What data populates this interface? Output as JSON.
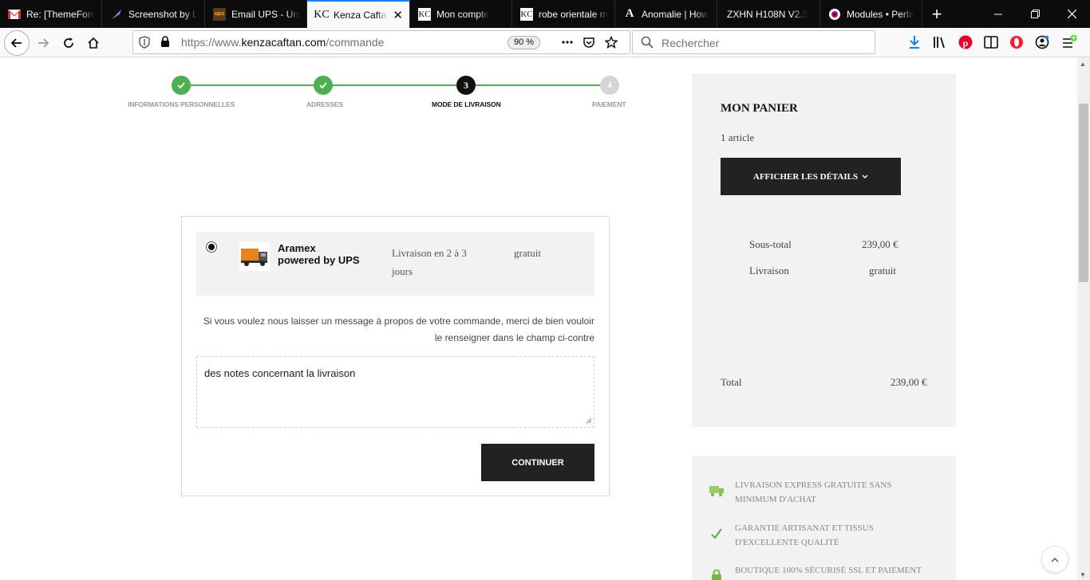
{
  "browser": {
    "tabs": [
      {
        "label": "Re: [ThemeForest]",
        "icon": "gmail-icon",
        "active": false
      },
      {
        "label": "Screenshot by Lightshot",
        "icon": "lightshot-icon",
        "active": false
      },
      {
        "label": "Email UPS - United States",
        "icon": "ups-icon",
        "active": false
      },
      {
        "label": "Kenza Caftan",
        "icon": "kc-icon",
        "active": true
      },
      {
        "label": "Mon compte",
        "icon": "kc-icon",
        "active": false
      },
      {
        "label": "robe orientale mariage",
        "icon": "kc-icon",
        "active": false
      },
      {
        "label": "Anomalie | How",
        "icon": "anomalie-icon",
        "active": false
      },
      {
        "label": "ZXHN H108N V2.3",
        "icon": "",
        "active": false
      },
      {
        "label": "Modules • Perla",
        "icon": "prestashop-icon",
        "active": false
      }
    ],
    "url_prefix": "https://www.",
    "url_domain": "kenzacaftan.com",
    "url_path": "/commande",
    "zoom": "90 %",
    "search_placeholder": "Rechercher",
    "tab_close": "✕",
    "new_tab": "+"
  },
  "checkout": {
    "steps": [
      {
        "number": "1",
        "label": "Informations personnelles",
        "status": "done"
      },
      {
        "number": "2",
        "label": "Adresses",
        "status": "done"
      },
      {
        "number": "3",
        "label": "Mode de livraison",
        "status": "current"
      },
      {
        "number": "4",
        "label": "Paiement",
        "status": "todo"
      }
    ],
    "carrier": {
      "name": "Aramex\npowered by UPS",
      "delay": "Livraison en 2 à 3 jours",
      "price": "gratuit",
      "selected": true
    },
    "message_prompt": "Si vous voulez nous laisser un message à propos de votre commande, merci de bien vouloir le renseigner dans le champ ci-contre",
    "notes_value": "des  notes concernant la livraison",
    "continue_label": "Continuer"
  },
  "cart": {
    "title": "Mon panier",
    "count": "1 article",
    "details_label": "Afficher les détails",
    "subtotal_label": "Sous-total",
    "subtotal_value": "239,00 €",
    "shipping_label": "Livraison",
    "shipping_value": "gratuit",
    "total_label": "Total",
    "total_value": "239,00 €"
  },
  "reassurance": [
    {
      "icon": "truck-icon",
      "text": "Livraison express gratuite sans minimum d'achat"
    },
    {
      "icon": "checkmark-icon",
      "text": "Garantie artisanat et tissus d'excellente qualité"
    },
    {
      "icon": "lock-icon",
      "text": "Boutique 100% sécurisé SSL et paiement"
    }
  ],
  "colors": {
    "accent_green": "#4caf50",
    "dark": "#222222",
    "panel_grey": "#f2f2f2",
    "firefox_blue": "#0a84ff"
  }
}
